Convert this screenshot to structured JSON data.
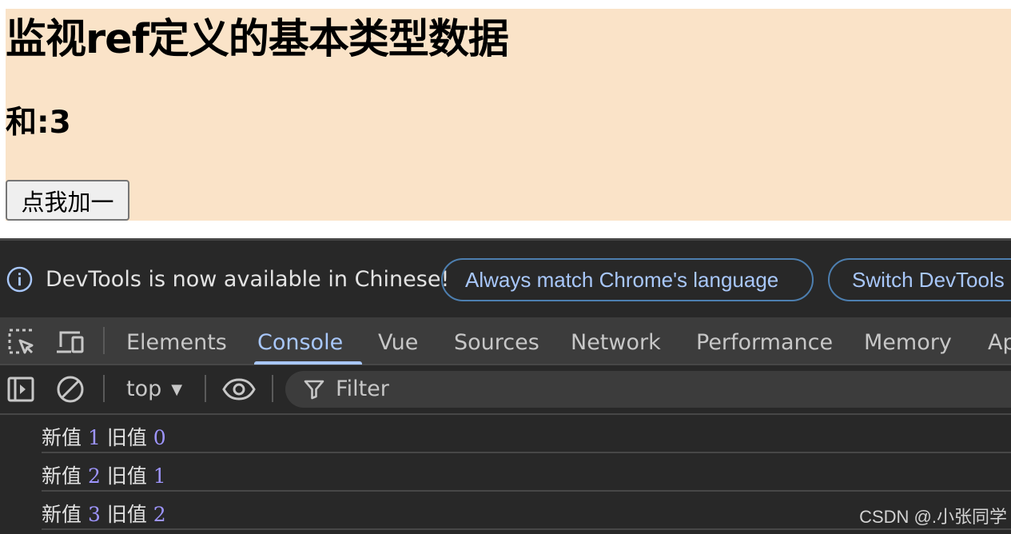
{
  "demo": {
    "title": "监视ref定义的基本类型数据",
    "sum_label": "和:3",
    "button_label": "点我加一",
    "background": "#fae3c8"
  },
  "devtools": {
    "infobar": {
      "message": "DevTools is now available in Chinese!",
      "match_language_button": "Always match Chrome's language",
      "switch_button": "Switch DevTools"
    },
    "tabs": [
      {
        "label": "Elements",
        "active": false
      },
      {
        "label": "Console",
        "active": true
      },
      {
        "label": "Vue",
        "active": false
      },
      {
        "label": "Sources",
        "active": false
      },
      {
        "label": "Network",
        "active": false
      },
      {
        "label": "Performance",
        "active": false
      },
      {
        "label": "Memory",
        "active": false
      },
      {
        "label": "Ap",
        "active": false
      }
    ],
    "toolbar_icons": {
      "inspect": "inspect-element-icon",
      "device": "device-toolbar-icon",
      "sidebar": "console-sidebar-icon",
      "clear": "clear-console-icon",
      "live": "live-expression-eye-icon",
      "filter": "filter-icon"
    },
    "console": {
      "context": "top",
      "filter_placeholder": "Filter",
      "messages": [
        {
          "new_label": "新值",
          "new_value": "1",
          "old_label": "旧值",
          "old_value": "0"
        },
        {
          "new_label": "新值",
          "new_value": "2",
          "old_label": "旧值",
          "old_value": "1"
        },
        {
          "new_label": "新值",
          "new_value": "3",
          "old_label": "旧值",
          "old_value": "2"
        }
      ]
    },
    "colors": {
      "accent": "#a8c7fa",
      "number": "#9e95ff",
      "panel_bg": "#282828"
    }
  },
  "watermark": "CSDN @.小张同学"
}
